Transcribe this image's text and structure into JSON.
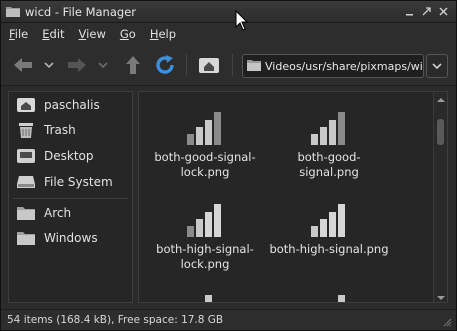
{
  "window": {
    "title": "wicd - File Manager"
  },
  "menubar": {
    "items": [
      "File",
      "Edit",
      "View",
      "Go",
      "Help"
    ]
  },
  "toolbar": {
    "icons": [
      "back-arrow-icon",
      "chevron-down-icon",
      "forward-arrow-icon",
      "chevron-down-icon",
      "up-arrow-icon",
      "reload-icon",
      "home-icon"
    ]
  },
  "location": {
    "path": "Videos/usr/share/pixmaps/wicd"
  },
  "sidebar": {
    "items": [
      {
        "label": "paschalis",
        "icon": "home-folder-icon"
      },
      {
        "label": "Trash",
        "icon": "trash-icon"
      },
      {
        "label": "Desktop",
        "icon": "desktop-icon"
      },
      {
        "label": "File System",
        "icon": "drive-icon"
      },
      {
        "label": "Arch",
        "icon": "folder-icon"
      },
      {
        "label": "Windows",
        "icon": "folder-icon"
      }
    ]
  },
  "files": [
    {
      "name": "both-good-signal-lock.png",
      "line1": "both-good-signal-",
      "line2": "lock.png",
      "icon": "signal-good-icon"
    },
    {
      "name": "both-good-signal.png",
      "line1": "both-good-",
      "line2": "signal.png",
      "icon": "signal-good-icon"
    },
    {
      "name": "both-high-signal-lock.png",
      "line1": "both-high-signal-",
      "line2": "lock.png",
      "icon": "signal-high-icon"
    },
    {
      "name": "both-high-signal.png",
      "line1": "both-high-signal.png",
      "line2": "",
      "icon": "signal-high-icon"
    }
  ],
  "statusbar": {
    "text": "54 items (168.4 kB), Free space: 17.8 GB"
  },
  "colors": {
    "background": "#2b2b2b",
    "pane": "#262626",
    "text": "#e2e2e2",
    "reload_accent": "#3b8fe0"
  }
}
